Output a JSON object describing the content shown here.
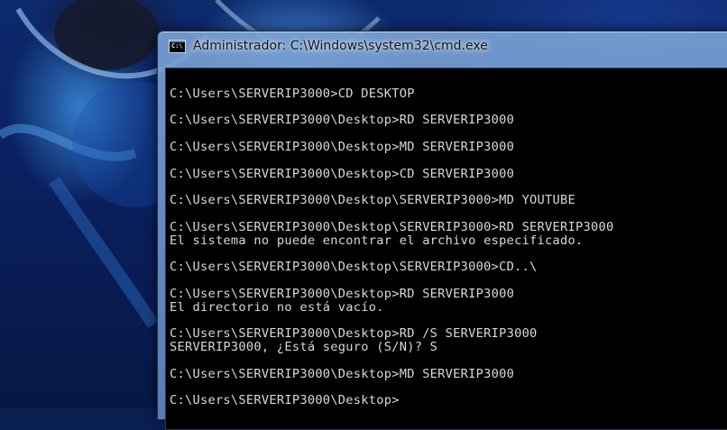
{
  "window": {
    "title": "Administrador: C:\\Windows\\system32\\cmd.exe",
    "icon_label": "C:\\",
    "icon": "cmd-icon"
  },
  "console": {
    "lines": [
      "",
      "C:\\Users\\SERVERIP3000>CD DESKTOP",
      "",
      "C:\\Users\\SERVERIP3000\\Desktop>RD SERVERIP3000",
      "",
      "C:\\Users\\SERVERIP3000\\Desktop>MD SERVERIP3000",
      "",
      "C:\\Users\\SERVERIP3000\\Desktop>CD SERVERIP3000",
      "",
      "C:\\Users\\SERVERIP3000\\Desktop\\SERVERIP3000>MD YOUTUBE",
      "",
      "C:\\Users\\SERVERIP3000\\Desktop\\SERVERIP3000>RD SERVERIP3000",
      "El sistema no puede encontrar el archivo especificado.",
      "",
      "C:\\Users\\SERVERIP3000\\Desktop\\SERVERIP3000>CD..\\",
      "",
      "C:\\Users\\SERVERIP3000\\Desktop>RD SERVERIP3000",
      "El directorio no está vacío.",
      "",
      "C:\\Users\\SERVERIP3000\\Desktop>RD /S SERVERIP3000",
      "SERVERIP3000, ¿Está seguro (S/N)? S",
      "",
      "C:\\Users\\SERVERIP3000\\Desktop>MD SERVERIP3000",
      "",
      "C:\\Users\\SERVERIP3000\\Desktop>"
    ]
  },
  "colors": {
    "console_background": "#000000",
    "console_text": "#d8d8d8",
    "desktop_background": "#0a1f52"
  }
}
